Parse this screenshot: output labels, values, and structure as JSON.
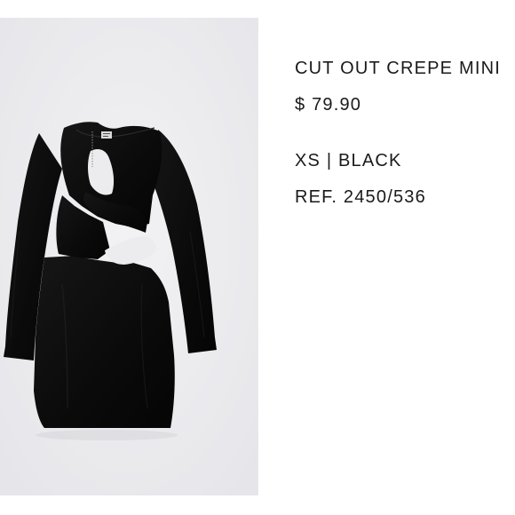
{
  "product": {
    "title": "CUT OUT CREPE MINI",
    "price": "$ 79.90",
    "variant": "XS | BLACK",
    "reference": "REF. 2450/536"
  },
  "image": {
    "subject": "black long-sleeve cut-out mini dress",
    "background_color": "#ececef",
    "garment_color": "#0b0b0b"
  }
}
